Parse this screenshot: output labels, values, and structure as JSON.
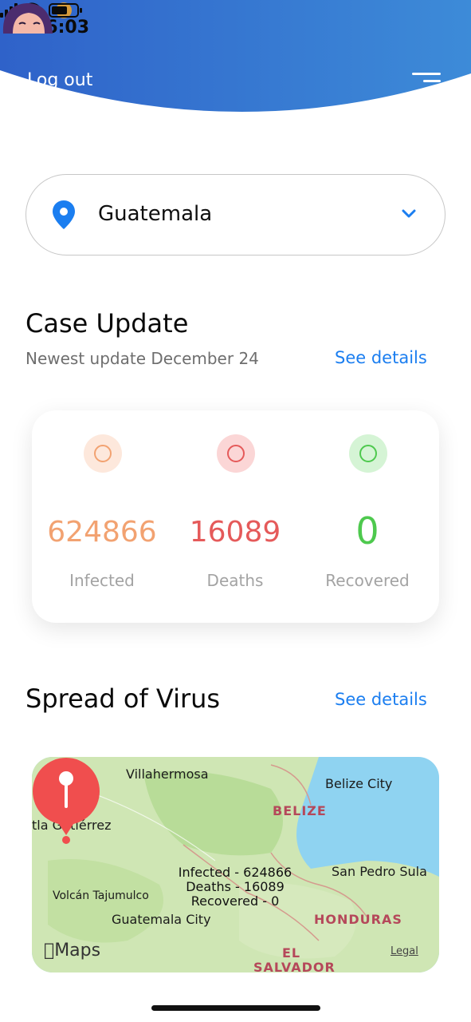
{
  "status_bar": {
    "time": "16:03"
  },
  "header": {
    "logout_label": "Log out"
  },
  "location": {
    "country": "Guatemala"
  },
  "case_update": {
    "title": "Case Update",
    "subtitle": "Newest update December 24",
    "see_details_label": "See details",
    "stats": [
      {
        "value": "624866",
        "label": "Infected",
        "color": "#f2a271"
      },
      {
        "value": "16089",
        "label": "Deaths",
        "color": "#e55a5a"
      },
      {
        "value": "0",
        "label": "Recovered",
        "color": "#4ec94e"
      }
    ]
  },
  "spread": {
    "title": "Spread of Virus",
    "see_details_label": "See details",
    "map": {
      "places": [
        "Villahermosa",
        "Belize City",
        "tla Gutiérrez",
        "San Pedro Sula",
        "Volcán Tajumulco",
        "Guatemala City"
      ],
      "countries": [
        "BELIZE",
        "HONDURAS",
        "EL",
        "SALVADOR"
      ],
      "callout": [
        "Infected - 624866",
        "Deaths - 16089",
        "Recovered - 0"
      ],
      "brand": "Maps",
      "legal": "Legal"
    }
  },
  "colors": {
    "accent": "#1b7ef0",
    "header_blue": "#2f6fd0"
  }
}
